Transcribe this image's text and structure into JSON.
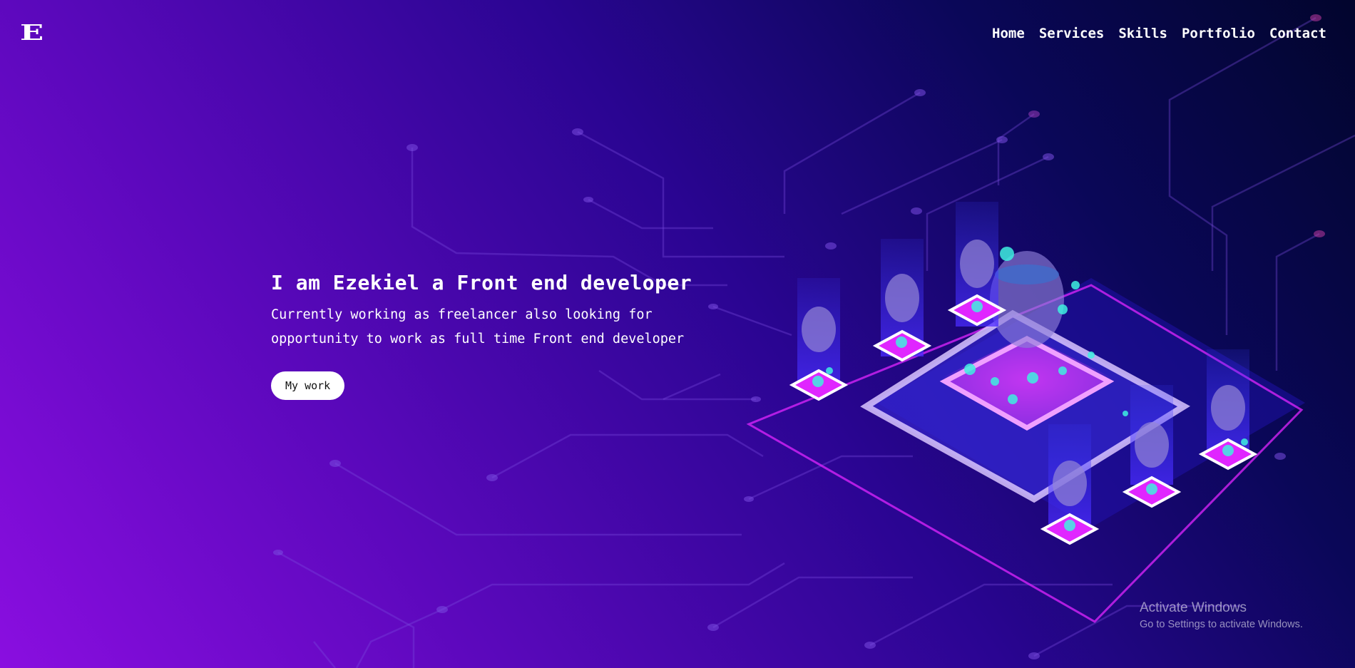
{
  "header": {
    "logo": "E",
    "nav": [
      "Home",
      "Services",
      "Skills",
      "Portfolio",
      "Contact"
    ]
  },
  "hero": {
    "title": "I am Ezekiel a Front end developer",
    "subtitle": "Currently working as freelancer also looking for opportunity to work as full time Front end developer",
    "button_label": "My work"
  },
  "watermark": {
    "title": "Activate Windows",
    "subtitle": "Go to Settings to activate Windows."
  },
  "colors": {
    "bg_left": "#8a0ee0",
    "bg_right": "#02052d",
    "text": "#ffffff",
    "accent_magenta": "#e026ff",
    "accent_cyan": "#3ef0e0"
  }
}
